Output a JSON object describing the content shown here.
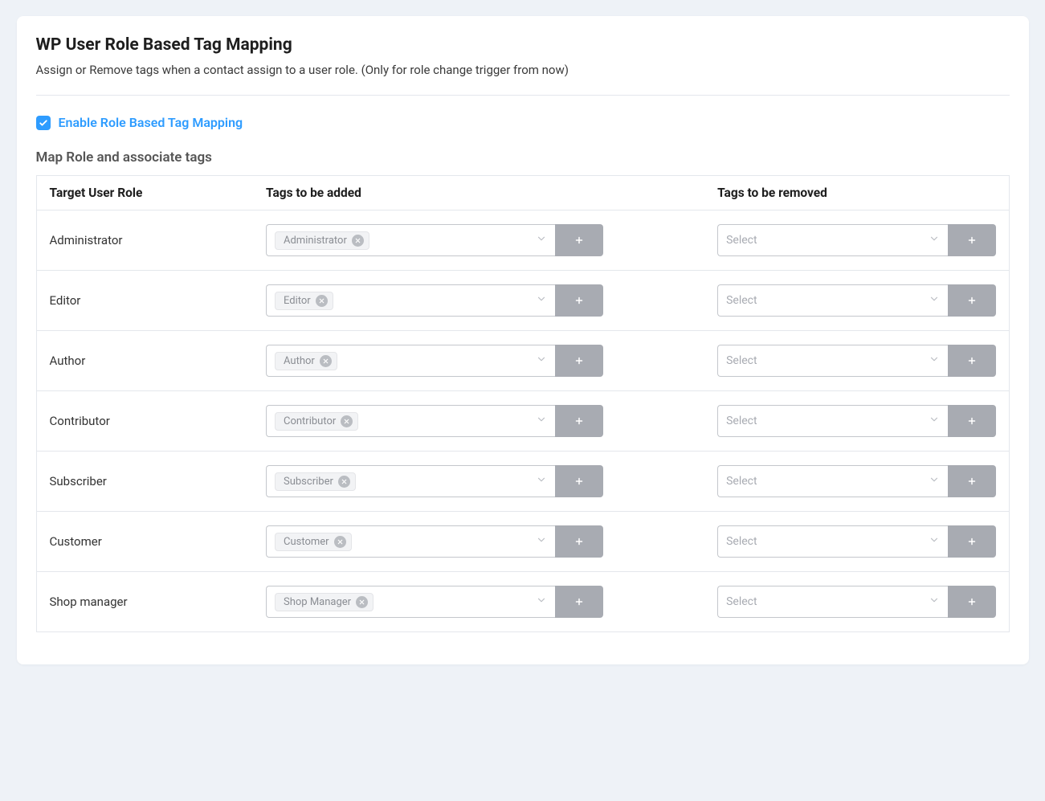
{
  "header": {
    "title": "WP User Role Based Tag Mapping",
    "description": "Assign or Remove tags when a contact assign to a user role. (Only for role change trigger from now)"
  },
  "enable": {
    "label": "Enable Role Based Tag Mapping",
    "checked": true
  },
  "subheading": "Map Role and associate tags",
  "columns": {
    "role": "Target User Role",
    "add": "Tags to be added",
    "remove": "Tags to be removed"
  },
  "select_placeholder": "Select",
  "rows": [
    {
      "role": "Administrator",
      "add_tags": [
        "Administrator"
      ],
      "remove_tags": []
    },
    {
      "role": "Editor",
      "add_tags": [
        "Editor"
      ],
      "remove_tags": []
    },
    {
      "role": "Author",
      "add_tags": [
        "Author"
      ],
      "remove_tags": []
    },
    {
      "role": "Contributor",
      "add_tags": [
        "Contributor"
      ],
      "remove_tags": []
    },
    {
      "role": "Subscriber",
      "add_tags": [
        "Subscriber"
      ],
      "remove_tags": []
    },
    {
      "role": "Customer",
      "add_tags": [
        "Customer"
      ],
      "remove_tags": []
    },
    {
      "role": "Shop manager",
      "add_tags": [
        "Shop Manager"
      ],
      "remove_tags": []
    }
  ]
}
